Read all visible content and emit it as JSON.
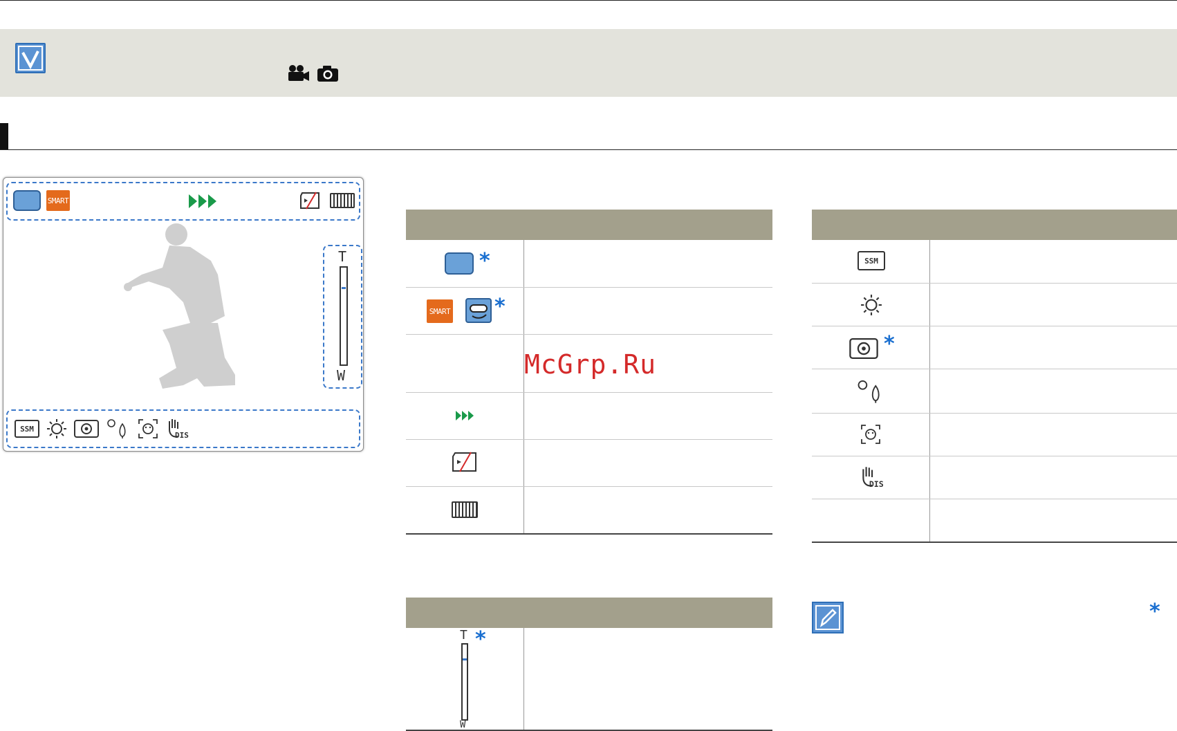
{
  "watermark": "McGrp.Ru",
  "icons": {
    "check": "checkmark-icon",
    "movie": "movie-camera-icon",
    "photo": "camera-icon",
    "scene": "blue-camera-icon",
    "smart": "SMART",
    "underwater": "diver-mask-icon",
    "playback_speed": "fast-forward-icon",
    "no_card": "no-card-icon",
    "battery": "battery-icon",
    "ssm": "SSM",
    "brightness": "sun-icon",
    "stabilizer": "lens-icon",
    "backlight": "backlight-icon",
    "face": "face-detection-icon",
    "dis": "DIS",
    "note": "note-pencil-icon"
  },
  "preview": {
    "zoom_top": "T",
    "zoom_bottom": "W"
  },
  "table_zoom": {
    "zoom_top": "T",
    "zoom_bottom": "W"
  },
  "colors": {
    "accent_blue": "#3a78c9",
    "smart_orange": "#e46a1c",
    "play_green": "#1a9a4a",
    "header_tan": "#a3a08c",
    "banner_gray": "#e3e3dc",
    "star_blue": "#1a6fd0"
  }
}
